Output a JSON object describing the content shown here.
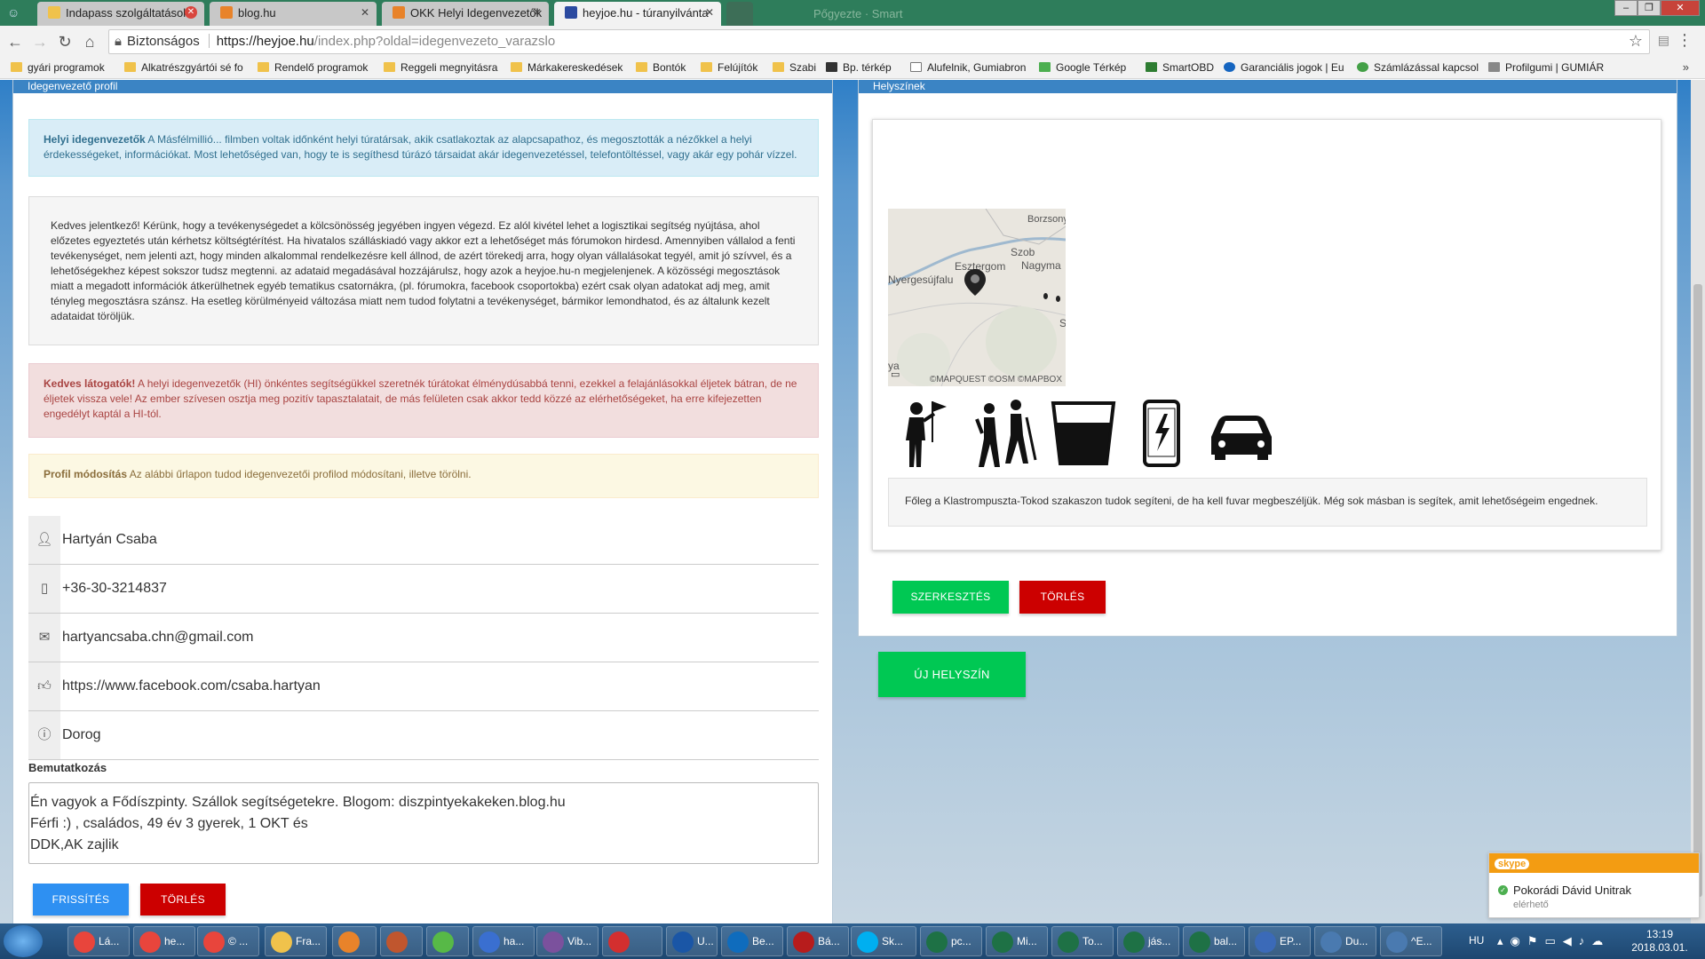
{
  "browser": {
    "window_title": "Pőgyezte · Smart",
    "tabs": [
      {
        "label": "Indapass szolgáltatások",
        "favicon_color": "#f0c24b",
        "active": false
      },
      {
        "label": "blog.hu",
        "favicon_color": "#e8832a",
        "active": false
      },
      {
        "label": "OKK Helyi Idegenvezetők",
        "favicon_color": "#e8832a",
        "active": false
      },
      {
        "label": "heyjoe.hu - túranyilvánta",
        "favicon_color": "#2b4aa0",
        "active": true
      }
    ],
    "address": {
      "secure_label": "Biztonságos",
      "host": "https://heyjoe.hu",
      "path": "/index.php?oldal=idegenvezeto_varazslo"
    },
    "bookmarks": [
      "gyári programok",
      "Alkatrészgyártói sé fo",
      "Rendelő programok",
      "Reggeli megnyitásra",
      "Márkakereskedések",
      "Bontók",
      "Felújítók",
      "Szabi",
      "Bp. térkép",
      "Alufelnik, Gumiabron",
      "Google Térkép",
      "SmartOBD",
      "Garanciális jogok | Eu",
      "Számlázással kapcsol",
      "Profilgumi | GUMIÁR"
    ]
  },
  "left_panel": {
    "heading": "Idegenvezető profil",
    "info_alert": {
      "title": "Helyi idegenvezetők",
      "text": " A Másfélmillió... filmben voltak időnként helyi túratársak, akik csatlakoztak az alapcsapathoz, és megosztották a nézőkkel a helyi érdekességeket, információkat. Most lehetőséged van, hogy te is segíthesd túrázó társaidat akár idegenvezetéssel, telefontöltéssel, vagy akár egy pohár vízzel."
    },
    "notice_text": "Kedves jelentkező! Kérünk, hogy a tevékenységedet a kölcsönösség jegyében ingyen végezd. Ez alól kivétel lehet a logisztikai segítség nyújtása, ahol előzetes egyeztetés után kérhetsz költségtérítést. Ha hivatalos szálláskiadó vagy akkor ezt a lehetőséget más fórumokon hirdesd. Amennyiben vállalod a fenti tevékenységet, nem jelenti azt, hogy minden alkalommal rendelkezésre kell állnod, de azért törekedj arra, hogy olyan vállalásokat tegyél, amit jó szívvel, és a lehetőségekhez képest sokszor tudsz megtenni. az adataid megadásával hozzájárulsz, hogy azok a heyjoe.hu-n megjelenjenek. A közösségi megosztások miatt a megadott információk átkerülhetnek egyéb tematikus csatornákra, (pl. fórumokra, facebook csoportokba) ezért csak olyan adatokat adj meg, amit tényleg megosztásra szánsz. Ha esetleg körülményeid változása miatt nem tudod folytatni a tevékenységet, bármikor lemondhatod, és az általunk kezelt adataidat töröljük.",
    "danger_alert": {
      "title": "Kedves látogatók!",
      "text": " A helyi idegenvezetők (HI) önkéntes segítségükkel szeretnék túrátokat élménydúsabbá tenni, ezekkel a felajánlásokkal éljetek bátran, de ne éljetek vissza vele! Az ember szívesen osztja meg pozitív tapasztalatait, de más felületen csak akkor tedd közzé az elérhetőségeket, ha erre kifejezetten engedélyt kaptál a HI-tól."
    },
    "warning_alert": {
      "title": "Profil módosítás",
      "text": " Az alábbi űrlapon tudod idegenvezetői profilod módosítani, illetve törölni."
    },
    "fields": {
      "name": "Hartyán Csaba",
      "phone": "+36-30-3214837",
      "email": "hartyancsaba.chn@gmail.com",
      "facebook": "https://www.facebook.com/csaba.hartyan",
      "city": "Dorog"
    },
    "intro_label": "Bemutatkozás",
    "intro_text": "Én vagyok a Fődíszpinty. Szállok segítségetekre. Blogom: diszpintyekakeken.blog.hu\nFérfi :) , családos, 49 év 3 gyerek, 1 OKT és\nDDK,AK zajlik",
    "refresh_button": "FRISSÍTÉS",
    "delete_button": "TÖRLÉS"
  },
  "right_panel": {
    "heading": "Helyszínek",
    "map": {
      "labels": [
        "Borzsony",
        "Szob",
        "Esztergom",
        "Nagyma",
        "Nyergesújfalu",
        "ya",
        "S"
      ],
      "attribution": "©MAPQUEST ©OSM ©MAPBOX"
    },
    "service_icons": [
      "guide-icon",
      "hikers-icon",
      "water-glass-icon",
      "phone-charging-icon",
      "car-icon"
    ],
    "description": "Főleg a Klastrompuszta-Tokod szakaszon tudok segíteni, de ha kell fuvar megbeszéljük. Még sok másban is segítek, amit lehetőségeim engednek.",
    "edit_button": "SZERKESZTÉS",
    "delete_button": "TÖRLÉS",
    "new_location_button": "ÚJ HELYSZÍN"
  },
  "skype": {
    "logo": "skype",
    "name": "Pokorádi Dávid Unitrak",
    "status": "elérhető"
  },
  "taskbar": {
    "items": [
      {
        "label": "Lá...",
        "color": "#e8453c"
      },
      {
        "label": "he...",
        "color": "#e8453c"
      },
      {
        "label": "© ...",
        "color": "#e8453c"
      },
      {
        "label": "Fra...",
        "color": "#f0c24b"
      },
      {
        "label": "",
        "color": "#e8832a"
      },
      {
        "label": "",
        "color": "#c0562e"
      },
      {
        "label": "",
        "color": "#57b947"
      },
      {
        "label": "ha...",
        "color": "#3a6fd0"
      },
      {
        "label": "Vib...",
        "color": "#7b519d"
      },
      {
        "label": "",
        "color": "#d32f2f"
      },
      {
        "label": "U...",
        "color": "#1a56a6"
      },
      {
        "label": "Be...",
        "color": "#0f6cbd"
      },
      {
        "label": "Bá...",
        "color": "#b71c1c"
      },
      {
        "label": "Sk...",
        "color": "#00aff0"
      },
      {
        "label": "pc...",
        "color": "#1e7145"
      },
      {
        "label": "Mi...",
        "color": "#1e7145"
      },
      {
        "label": "To...",
        "color": "#1e7145"
      },
      {
        "label": "jás...",
        "color": "#1e7145"
      },
      {
        "label": "bal...",
        "color": "#1e7145"
      },
      {
        "label": "EP...",
        "color": "#3b6ab8"
      },
      {
        "label": "Du...",
        "color": "#4a7ab0"
      },
      {
        "label": "^E...",
        "color": "#4a7ab0"
      }
    ],
    "language": "HU",
    "time": "13:19",
    "date": "2018.03.01."
  }
}
